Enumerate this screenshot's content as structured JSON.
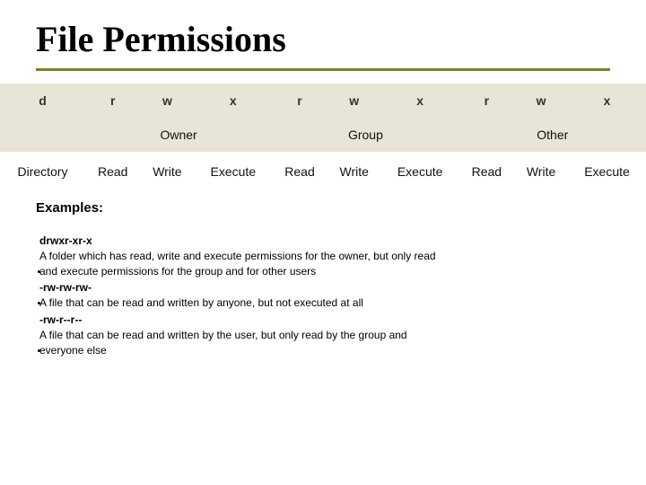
{
  "title": "File Permissions",
  "perm_letters": [
    "d",
    "r",
    "w",
    "x",
    "r",
    "w",
    "x",
    "r",
    "w",
    "x"
  ],
  "perm_categories": {
    "blank": "",
    "owner": "Owner",
    "group": "Group",
    "other": "Other"
  },
  "perm_meanings": [
    "Directory",
    "Read",
    "Write",
    "Execute",
    "Read",
    "Write",
    "Execute",
    "Read",
    "Write",
    "Execute"
  ],
  "examples_heading": "Examples:",
  "examples": [
    {
      "code": "drwxr-xr-x",
      "desc_l1": "A folder which has read, write and execute permissions for the owner, but only read",
      "desc_l2": "and execute permissions for the group and for other users"
    },
    {
      "code": "-rw-rw-rw-",
      "desc_l1": "A file that can be read and written by anyone, but not executed at all",
      "desc_l2": ""
    },
    {
      "code": "-rw-r--r--",
      "desc_l1": "A file that can be read and written by the user, but only read by the group and",
      "desc_l2": "everyone else"
    }
  ],
  "chart_data": {
    "type": "table",
    "title": "File Permissions",
    "columns": [
      "d",
      "r",
      "w",
      "x",
      "r",
      "w",
      "x",
      "r",
      "w",
      "x"
    ],
    "column_groups": [
      "",
      "Owner",
      "Owner",
      "Owner",
      "Group",
      "Group",
      "Group",
      "Other",
      "Other",
      "Other"
    ],
    "meanings": [
      "Directory",
      "Read",
      "Write",
      "Execute",
      "Read",
      "Write",
      "Execute",
      "Read",
      "Write",
      "Execute"
    ],
    "examples": [
      {
        "perm": "drwxr-xr-x",
        "meaning": "A folder which has read, write and execute permissions for the owner, but only read and execute permissions for the group and for other users"
      },
      {
        "perm": "-rw-rw-rw-",
        "meaning": "A file that can be read and written by anyone, but not executed at all"
      },
      {
        "perm": "-rw-r--r--",
        "meaning": "A file that can be read and written by the user, but only read by the group and everyone else"
      }
    ]
  }
}
